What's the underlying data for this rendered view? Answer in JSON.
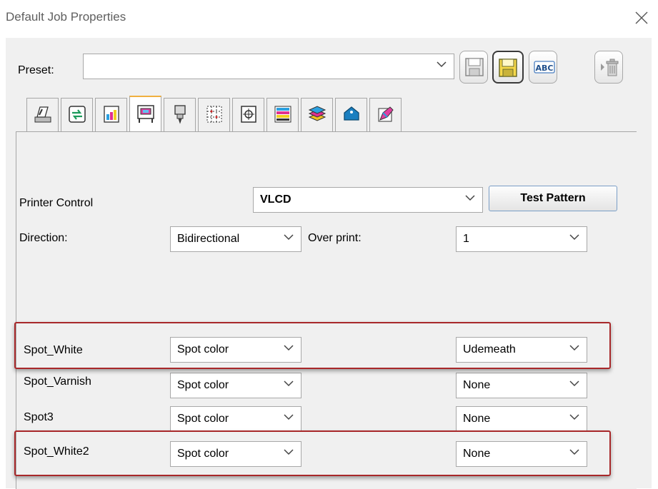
{
  "window": {
    "title": "Default Job Properties"
  },
  "preset": {
    "label": "Preset:",
    "value": ""
  },
  "toolbar": {
    "icons": [
      "save-icon",
      "save-as-icon",
      "rename-abc-icon",
      "delete-icon"
    ]
  },
  "tabs": [
    "printer-setup-icon",
    "import-export-icon",
    "color-swatch-icon",
    "printer-control-icon",
    "ink-nozzle-icon",
    "layout-grid-icon",
    "crop-marks-icon",
    "color-bars-icon",
    "layers-icon",
    "tag-icon",
    "eyedropper-icon"
  ],
  "printer_control": {
    "label": "Printer Control",
    "value": "VLCD",
    "test_button": "Test Pattern"
  },
  "direction": {
    "label": "Direction:",
    "value": "Bidirectional"
  },
  "overprint": {
    "label": "Over print:",
    "value": "1"
  },
  "spots": [
    {
      "name": "Spot_White",
      "type": "Spot color",
      "placement": "Udemeath",
      "highlighted": true
    },
    {
      "name": "Spot_Varnish",
      "type": "Spot color",
      "placement": "None",
      "highlighted": false
    },
    {
      "name": "Spot3",
      "type": "Spot color",
      "placement": "None",
      "highlighted": false
    },
    {
      "name": "Spot_White2",
      "type": "Spot color",
      "placement": "None",
      "highlighted": true
    }
  ],
  "colors": {
    "highlight": "#a8282a",
    "panel": "#f0f0f0",
    "active_tab_accent": "#f0b040"
  }
}
